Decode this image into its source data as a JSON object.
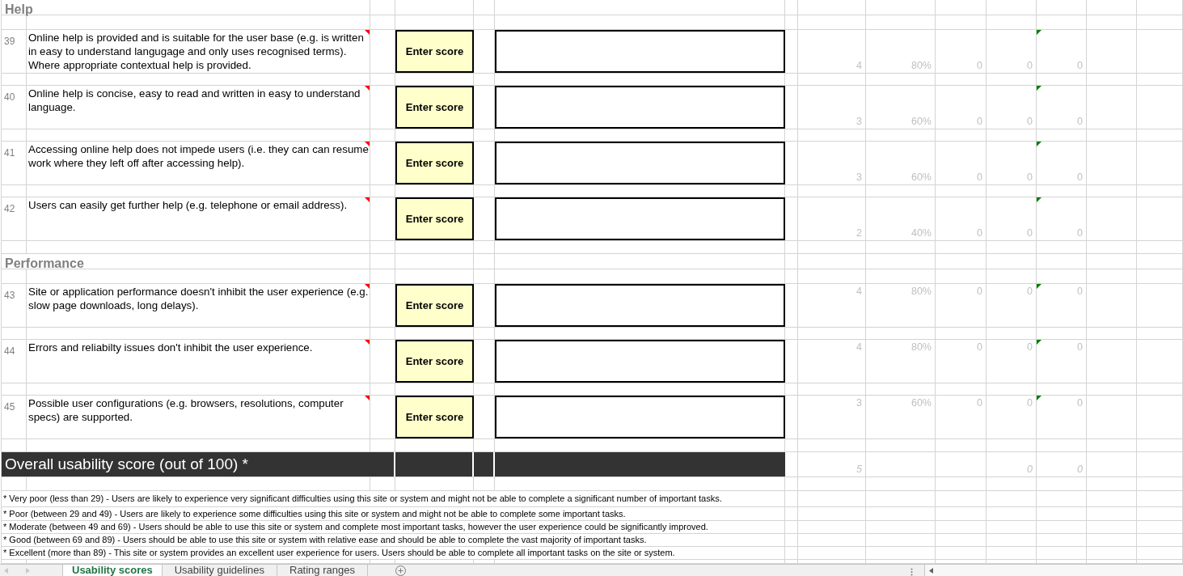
{
  "sections": [
    {
      "title": "Help",
      "rows": [
        {
          "number": "39",
          "text": "Online help is provided and is suitable for the user base (e.g. is written in easy to understand langugage and only uses recognised terms). Where appropriate contextual help is provided.",
          "commented": true,
          "score": "Enter score",
          "column_1": "4",
          "column_2": "80%",
          "column_3": "0",
          "column_4": "0",
          "column_5": "0",
          "column_5_flagged": true
        },
        {
          "number": "40",
          "text": "Online help is concise, easy to read and written in easy to understand language.",
          "commented": true,
          "score": "Enter score",
          "column_1": "3",
          "column_2": "60%",
          "column_3": "0",
          "column_4": "0",
          "column_5": "0",
          "column_5_flagged": true
        },
        {
          "number": "41",
          "text": "Accessing online help does not impede users (i.e. they can can resume work where they left off after accessing help).",
          "commented": true,
          "score": "Enter score",
          "column_1": "3",
          "column_2": "60%",
          "column_3": "0",
          "column_4": "0",
          "column_5": "0",
          "column_5_flagged": true
        },
        {
          "number": "42",
          "text": "Users can easily get further help (e.g. telephone or email address).",
          "commented": true,
          "score": "Enter score",
          "column_1": "2",
          "column_2": "40%",
          "column_3": "0",
          "column_4": "0",
          "column_5": "0",
          "column_5_flagged": true
        }
      ]
    },
    {
      "title": "Performance",
      "rows": [
        {
          "number": "43",
          "text": "Site or application performance doesn't inhibit the user experience (e.g. slow page downloads, long delays).",
          "commented": true,
          "score": "Enter score",
          "column_1": "4",
          "column_2": "80%",
          "column_3": "0",
          "column_4": "0",
          "column_5": "0",
          "column_5_flagged": true
        },
        {
          "number": "44",
          "text": "Errors and reliabilty issues don't inhibit the user experience.",
          "commented": true,
          "score": "Enter score",
          "column_1": "4",
          "column_2": "80%",
          "column_3": "0",
          "column_4": "0",
          "column_5": "0",
          "column_5_flagged": true
        },
        {
          "number": "45",
          "text": "Possible user configurations (e.g. browsers, resolutions, computer specs) are supported.",
          "commented": true,
          "score": "Enter score",
          "column_1": "3",
          "column_2": "60%",
          "column_3": "0",
          "column_4": "0",
          "column_5": "0",
          "column_5_flagged": true
        }
      ]
    }
  ],
  "overall": {
    "label": "Overall usability score (out of 100) *",
    "column_1": "5",
    "column_4": "0",
    "column_5": "0"
  },
  "footnotes": [
    "* Very poor (less than 29) - Users are likely to experience very significant difficulties using this site or system and might not be able to complete a significant number of important tasks.",
    "* Poor (between 29 and 49) - Users are likely to experience some difficulties using this site or system and might not be able to complete some important tasks.",
    "* Moderate (between 49 and 69) - Users should be able to use this site or system and complete most important tasks, however the user experience could be significantly improved.",
    "* Good (between 69 and 89) - Users should be able to use this site or system with relative ease and should be able to complete the vast majority of important tasks.",
    "* Excellent (more than 89) - This site or system provides an excellent user experience for users. Users should be able to complete all important tasks on the site or system."
  ],
  "sheet_tabs": [
    {
      "label": "Usability scores",
      "selected": true
    },
    {
      "label": "Usability guidelines",
      "selected": false
    },
    {
      "label": "Rating ranges",
      "selected": false
    }
  ]
}
